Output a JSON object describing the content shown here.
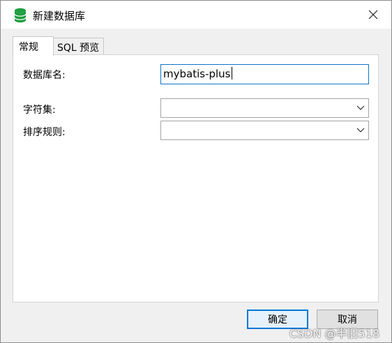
{
  "window": {
    "title": "新建数据库",
    "icon": "database-icon",
    "close_icon": "close-icon"
  },
  "tabs": [
    {
      "label": "常规",
      "active": true
    },
    {
      "label": "SQL 预览",
      "active": false
    }
  ],
  "form": {
    "db_name_label": "数据库名:",
    "db_name_value": "mybatis-plus",
    "charset_label": "字符集:",
    "charset_value": "",
    "collation_label": "排序规则:",
    "collation_value": ""
  },
  "buttons": {
    "ok_label": "确定",
    "cancel_label": "取消"
  },
  "watermark": "CSDN @半旧518",
  "colors": {
    "accent": "#0078d7",
    "db_icon": "#1e9e3e"
  }
}
